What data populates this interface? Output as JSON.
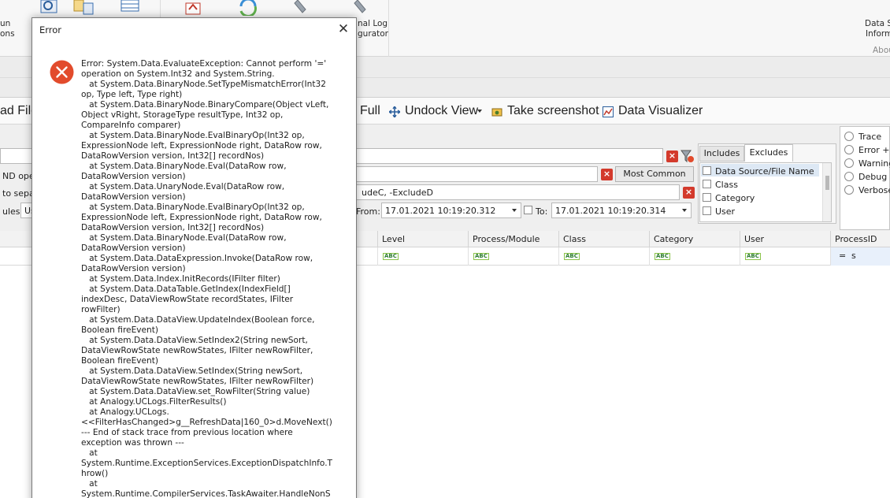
{
  "ribbon": {
    "left_label_1": "un",
    "left_label_2": "ons",
    "log_label_1": "nal Log",
    "log_label_2": "gurator",
    "right_label_1": "Data S",
    "right_label_2": "Inform",
    "right_group": "Abou"
  },
  "toolbar": {
    "load_file_label": "ad File",
    "full_label": "Full",
    "undock_label": "Undock View",
    "screenshot_label": "Take screenshot",
    "visualizer_label": "Data Visualizer"
  },
  "filter": {
    "and_text": "ND oper",
    "separate_text": "to sepa",
    "rules_label": "ules:",
    "rules_value": "Us",
    "excludes_value": "udeC, -ExcludeD",
    "most_common_label": "Most Common",
    "from_label": "From:",
    "from_value": "17.01.2021 10:19:20.312",
    "to_label": "To:",
    "to_value": "17.01.2021 10:19:20.314"
  },
  "tabs": {
    "includes": "Includes",
    "excludes": "Excludes"
  },
  "columns_list": [
    "Data Source/File Name",
    "Class",
    "Category",
    "User"
  ],
  "levels": [
    "Trace",
    "Error + (",
    "Warning",
    "Debug",
    "Verbose"
  ],
  "grid": {
    "headers": [
      "Level",
      "Process/Module",
      "Class",
      "Category",
      "User",
      "ProcessID"
    ],
    "abc_glyph": "ABC",
    "process_filter_op": "=",
    "process_filter_value": "s"
  },
  "dialog": {
    "title": "Error",
    "close_glyph": "✕",
    "message": "Error: System.Data.EvaluateException: Cannot perform '=' operation on System.Int32 and System.String.\n   at System.Data.BinaryNode.SetTypeMismatchError(Int32 op, Type left, Type right)\n   at System.Data.BinaryNode.BinaryCompare(Object vLeft, Object vRight, StorageType resultType, Int32 op, CompareInfo comparer)\n   at System.Data.BinaryNode.EvalBinaryOp(Int32 op, ExpressionNode left, ExpressionNode right, DataRow row, DataRowVersion version, Int32[] recordNos)\n   at System.Data.BinaryNode.Eval(DataRow row, DataRowVersion version)\n   at System.Data.UnaryNode.Eval(DataRow row, DataRowVersion version)\n   at System.Data.BinaryNode.EvalBinaryOp(Int32 op, ExpressionNode left, ExpressionNode right, DataRow row, DataRowVersion version, Int32[] recordNos)\n   at System.Data.BinaryNode.Eval(DataRow row, DataRowVersion version)\n   at System.Data.DataExpression.Invoke(DataRow row, DataRowVersion version)\n   at System.Data.Index.InitRecords(IFilter filter)\n   at System.Data.DataTable.GetIndex(IndexField[] indexDesc, DataViewRowState recordStates, IFilter rowFilter)\n   at System.Data.DataView.UpdateIndex(Boolean force, Boolean fireEvent)\n   at System.Data.DataView.SetIndex2(String newSort, DataViewRowState newRowStates, IFilter newRowFilter, Boolean fireEvent)\n   at System.Data.DataView.SetIndex(String newSort, DataViewRowState newRowStates, IFilter newRowFilter)\n   at System.Data.DataView.set_RowFilter(String value)\n   at Analogy.UCLogs.FilterResults()\n   at Analogy.UCLogs.<<FilterHasChanged>g__RefreshData|160_0>d.MoveNext()\n--- End of stack trace from previous location where exception was thrown ---\n   at System.Runtime.ExceptionServices.ExceptionDispatchInfo.Throw()\n   at System.Runtime.CompilerServices.TaskAwaiter.HandleNonSuccessAndDebuggerNotification(Task task)"
  },
  "colors": {
    "error_red": "#e24b2c",
    "accent_blue": "#3a6fb0"
  }
}
